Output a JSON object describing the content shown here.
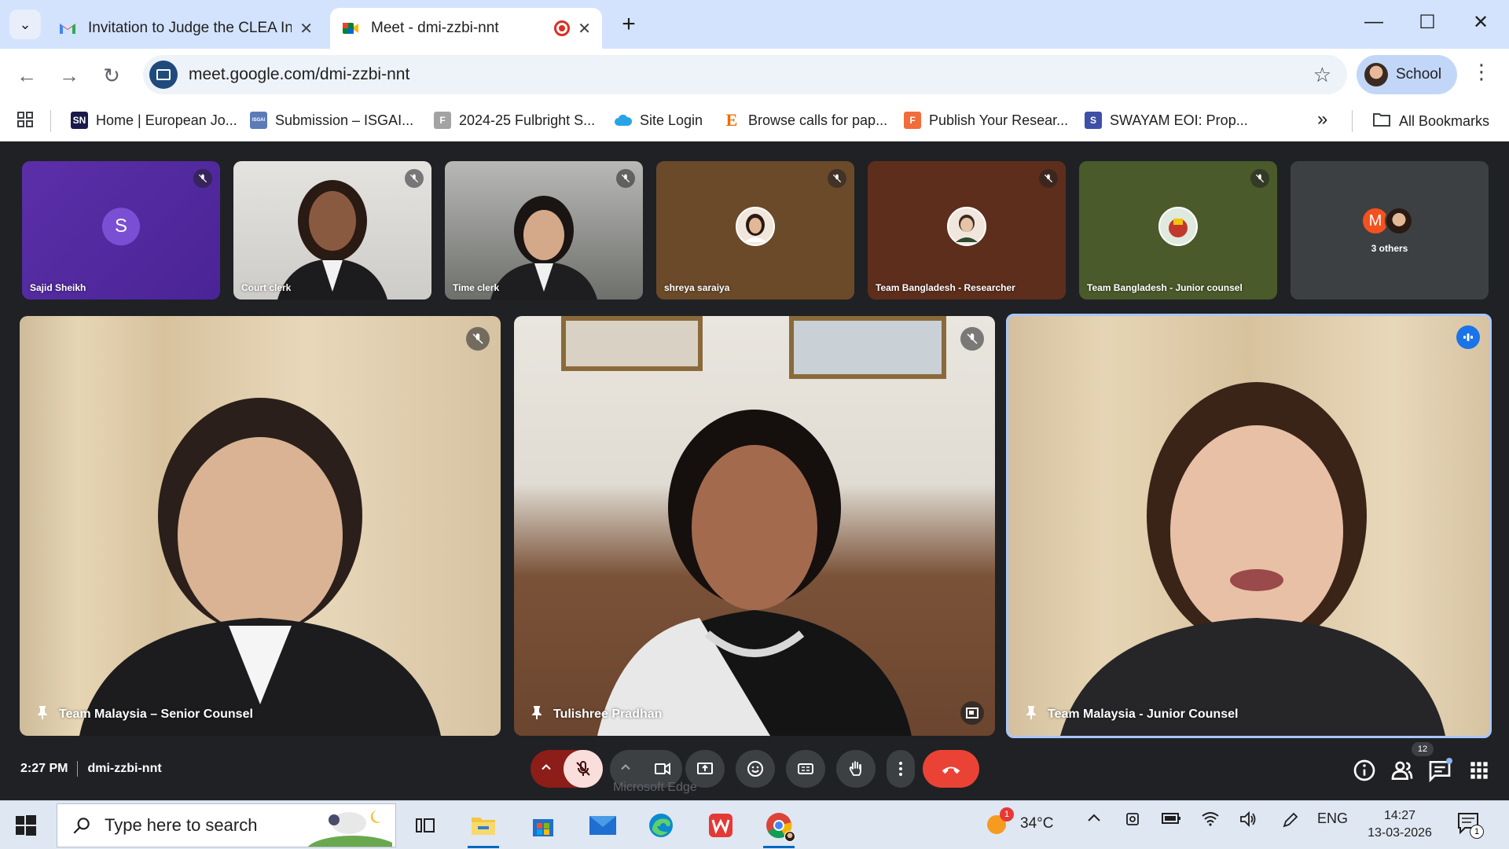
{
  "browser": {
    "tabs": [
      {
        "title": "Invitation to Judge the CLEA Int",
        "icon": "gmail-icon",
        "active": false
      },
      {
        "title": "Meet - dmi-zzbi-nnt",
        "icon": "meet-icon",
        "active": true
      }
    ],
    "url": "meet.google.com/dmi-zzbi-nnt",
    "profile_label": "School",
    "bookmarks": [
      {
        "label": "Home | European Jo...",
        "icon": "SN",
        "color": "#1a1a4a"
      },
      {
        "label": "Submission – ISGAI...",
        "icon": "ISGAI",
        "color": "#5b7bb8"
      },
      {
        "label": "2024-25 Fulbright S...",
        "icon": "F",
        "color": "#a3a3a3"
      },
      {
        "label": "Site Login",
        "icon": "cloud",
        "color": "#29a3e8"
      },
      {
        "label": "Browse calls for pap...",
        "icon": "E",
        "color": "#ef6c00"
      },
      {
        "label": "Publish Your Resear...",
        "icon": "F",
        "color": "#f26b3a"
      },
      {
        "label": "SWAYAM EOI: Prop...",
        "icon": "S",
        "color": "#3e4fa6"
      }
    ],
    "all_bookmarks_label": "All Bookmarks",
    "overflow_label": "»"
  },
  "meet": {
    "thumbnails": [
      {
        "name": "Sajid Sheikh",
        "type": "letter",
        "letter": "S",
        "bg": "#5a2ea6",
        "muted": true
      },
      {
        "name": "Court clerk",
        "type": "video",
        "bg": "#d9d7d3",
        "muted": true
      },
      {
        "name": "Time clerk",
        "type": "video",
        "bg": "#8a8c89",
        "muted": true
      },
      {
        "name": "shreya saraiya",
        "type": "avatar",
        "bg": "#6b4a2a",
        "muted": true
      },
      {
        "name": "Team Bangladesh - Researcher",
        "type": "avatar",
        "bg": "#5e2e1c",
        "muted": true
      },
      {
        "name": "Team Bangladesh - Junior counsel",
        "type": "avatar",
        "bg": "#4a5a2a",
        "muted": true
      },
      {
        "name": "",
        "type": "others",
        "bg": "#3c4043",
        "muted": false,
        "others_label": "3 others",
        "letter": "M"
      }
    ],
    "main_tiles": [
      {
        "name": "Team Malaysia – Senior Counsel",
        "muted": true,
        "speaking": false
      },
      {
        "name": "Tulishree Pradhan",
        "muted": true,
        "speaking": false
      },
      {
        "name": "Team Malaysia - Junior Counsel",
        "muted": false,
        "speaking": true
      }
    ],
    "time": "2:27 PM",
    "meeting_code": "dmi-zzbi-nnt",
    "tooltip": "Microsoft Edge",
    "participants_count": "12"
  },
  "taskbar": {
    "search_placeholder": "Type here to search",
    "weather_temp": "34°C",
    "weather_badge": "1",
    "language": "ENG",
    "clock_time": "14:27",
    "clock_date": "13-03-2026",
    "notification_count": "1"
  }
}
